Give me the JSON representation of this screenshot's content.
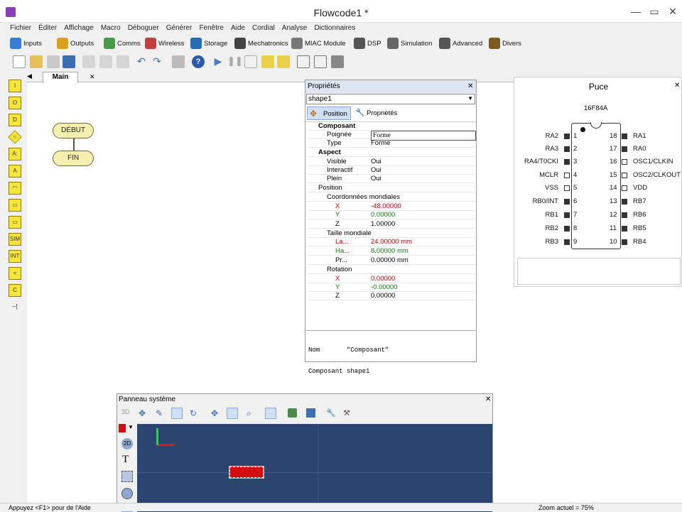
{
  "window": {
    "title": "Flowcode1 *"
  },
  "menu": [
    "Fichier",
    "Éditer",
    "Affichage",
    "Macro",
    "Déboguer",
    "Générer",
    "Fenêtre",
    "Aide",
    "Cordial",
    "Analyse",
    "Dictionnaires"
  ],
  "components_toolbar": [
    {
      "label": "Inputs",
      "icon": "inputs-icon",
      "color": "#3a7bd5"
    },
    {
      "label": "Outputs",
      "icon": "outputs-icon",
      "color": "#d9a21a"
    },
    {
      "label": "Comms",
      "icon": "comms-icon",
      "color": "#4a9a4a"
    },
    {
      "label": "Wireless",
      "icon": "wireless-icon",
      "color": "#c04040"
    },
    {
      "label": "Storage",
      "icon": "storage-icon",
      "color": "#2a6ab0"
    },
    {
      "label": "Mechatronics",
      "icon": "mechatronics-icon",
      "color": "#444444"
    },
    {
      "label": "MIAC Module",
      "icon": "miac-module-icon",
      "color": "#777777"
    },
    {
      "label": "DSP",
      "icon": "dsp-icon",
      "color": "#555555"
    },
    {
      "label": "Simulation",
      "icon": "simulation-icon",
      "color": "#666666"
    },
    {
      "label": "Advanced",
      "icon": "advanced-icon",
      "color": "#555555"
    },
    {
      "label": "Divers",
      "icon": "divers-icon",
      "color": "#7a5a20"
    }
  ],
  "canvas": {
    "tab": "Main",
    "tab_arrow": "◀",
    "tab_close": "✕",
    "start": "DÉBUT",
    "end": "FIN"
  },
  "palette": [
    "I",
    "O",
    "D",
    "◇",
    "A:",
    "A",
    "◠",
    "▭",
    "▭",
    "SIM",
    "INT",
    "=",
    "C",
    "--["
  ],
  "properties": {
    "title": "Propriétés",
    "selector": "shape1",
    "tab_position": "Position",
    "tab_props": "Propriétés",
    "rows": [
      {
        "label": "Composant",
        "value": "",
        "bold": true,
        "indent": 1
      },
      {
        "label": "Poignée",
        "value": "Forme",
        "indent": 2
      },
      {
        "label": "Type",
        "value": "Forme",
        "indent": 2
      },
      {
        "label": "Aspect",
        "value": "",
        "bold": true,
        "indent": 1
      },
      {
        "label": "Visible",
        "value": "Oui",
        "indent": 2
      },
      {
        "label": "Interactif",
        "value": "Oui",
        "indent": 2
      },
      {
        "label": "Plein",
        "value": "Oui",
        "indent": 2
      },
      {
        "label": "Position",
        "value": "",
        "indent": 1
      },
      {
        "label": "Coordonnées mondiales",
        "value": "",
        "indent": 2
      },
      {
        "label": "X",
        "value": "-48.00000",
        "indent": 3,
        "color": "#c00000"
      },
      {
        "label": "Y",
        "value": "0.00000",
        "indent": 3,
        "color": "#0a7a0a"
      },
      {
        "label": "Z",
        "value": "1.00000",
        "indent": 3
      },
      {
        "label": "Taille mondiale",
        "value": "",
        "indent": 2
      },
      {
        "label": "La...",
        "value": "24.00000 mm",
        "indent": 3,
        "color": "#c00000"
      },
      {
        "label": "Ha...",
        "value": "8.00000 mm",
        "indent": 3,
        "color": "#0a7a0a"
      },
      {
        "label": "Pr...",
        "value": "0.00000 mm",
        "indent": 3
      },
      {
        "label": "Rotation",
        "value": "",
        "indent": 2
      },
      {
        "label": "X",
        "value": "0.00000",
        "indent": 3,
        "color": "#c00000"
      },
      {
        "label": "Y",
        "value": "-0.00000",
        "indent": 3,
        "color": "#0a7a0a"
      },
      {
        "label": "Z",
        "value": "0.00000",
        "indent": 3
      }
    ],
    "info_line1": "Nom       \"Composant\"",
    "info_line2": "Composant shape1"
  },
  "chip": {
    "title": "Puce",
    "model": "16F84A",
    "left": [
      [
        "RA2",
        "1"
      ],
      [
        "RA3",
        "2"
      ],
      [
        "RA4/T0CKI",
        "3"
      ],
      [
        "MCLR",
        "4"
      ],
      [
        "VSS",
        "5"
      ],
      [
        "RB0/INT",
        "6"
      ],
      [
        "RB1",
        "7"
      ],
      [
        "RB2",
        "8"
      ],
      [
        "RB3",
        "9"
      ]
    ],
    "right": [
      [
        "18",
        "RA1"
      ],
      [
        "17",
        "RA0"
      ],
      [
        "16",
        "OSC1/CLKIN"
      ],
      [
        "15",
        "OSC2/CLKOUT"
      ],
      [
        "14",
        "VDD"
      ],
      [
        "13",
        "RB7"
      ],
      [
        "12",
        "RB6"
      ],
      [
        "11",
        "RB5"
      ],
      [
        "10",
        "RB4"
      ]
    ]
  },
  "system_panel": {
    "title": "Panneau système",
    "label_3d": "3D",
    "label_2d": "2D",
    "label_t": "T"
  },
  "status": {
    "help": "Appuyez <F1> pour de l'Aide",
    "zoom": "Zoom actuel = 75%"
  }
}
